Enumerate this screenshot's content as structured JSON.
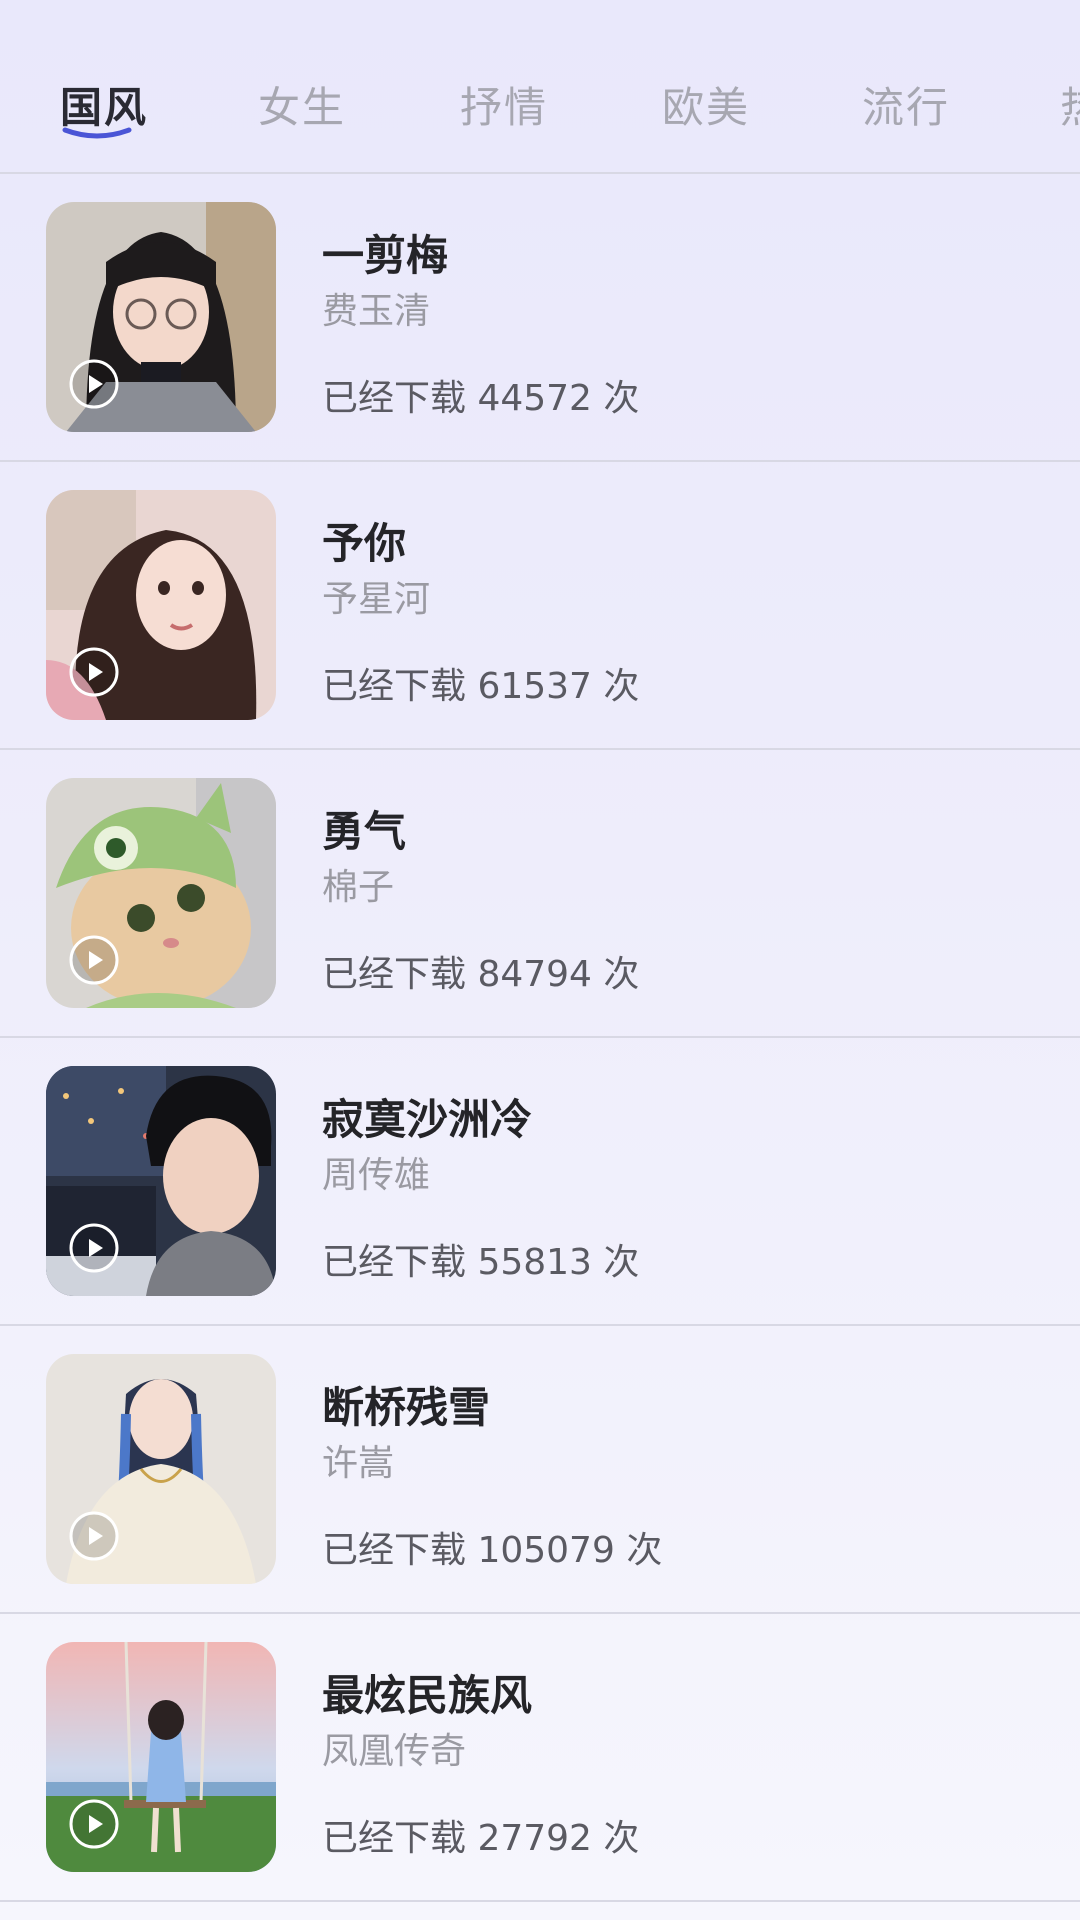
{
  "tabs": [
    {
      "label": "国风",
      "active": true
    },
    {
      "label": "女生",
      "active": false
    },
    {
      "label": "抒情",
      "active": false
    },
    {
      "label": "欧美",
      "active": false
    },
    {
      "label": "流行",
      "active": false
    },
    {
      "label": "热",
      "active": false
    }
  ],
  "songs": [
    {
      "title": "一剪梅",
      "artist": "费玉清",
      "downloads": "已经下载 44572 次",
      "cover": "girl-glasses-portrait"
    },
    {
      "title": "予你",
      "artist": "予星河",
      "downloads": "已经下载 61537 次",
      "cover": "girl-selfie-portrait"
    },
    {
      "title": "勇气",
      "artist": "棉子",
      "downloads": "已经下载 84794 次",
      "cover": "cat-in-green-hat"
    },
    {
      "title": "寂寞沙洲冷",
      "artist": "周传雄",
      "downloads": "已经下载 55813 次",
      "cover": "boy-night-city"
    },
    {
      "title": "断桥残雪",
      "artist": "许嵩",
      "downloads": "已经下载 105079 次",
      "cover": "girl-blue-braids"
    },
    {
      "title": "最炫民族风",
      "artist": "凤凰传奇",
      "downloads": "已经下载 27792 次",
      "cover": "girl-on-swing-illustration"
    }
  ],
  "colors": {
    "accent": "#4a55d6",
    "background": "#eceafb",
    "divider": "#d8d8e4"
  },
  "icons": {
    "play": "play-circle-icon"
  }
}
